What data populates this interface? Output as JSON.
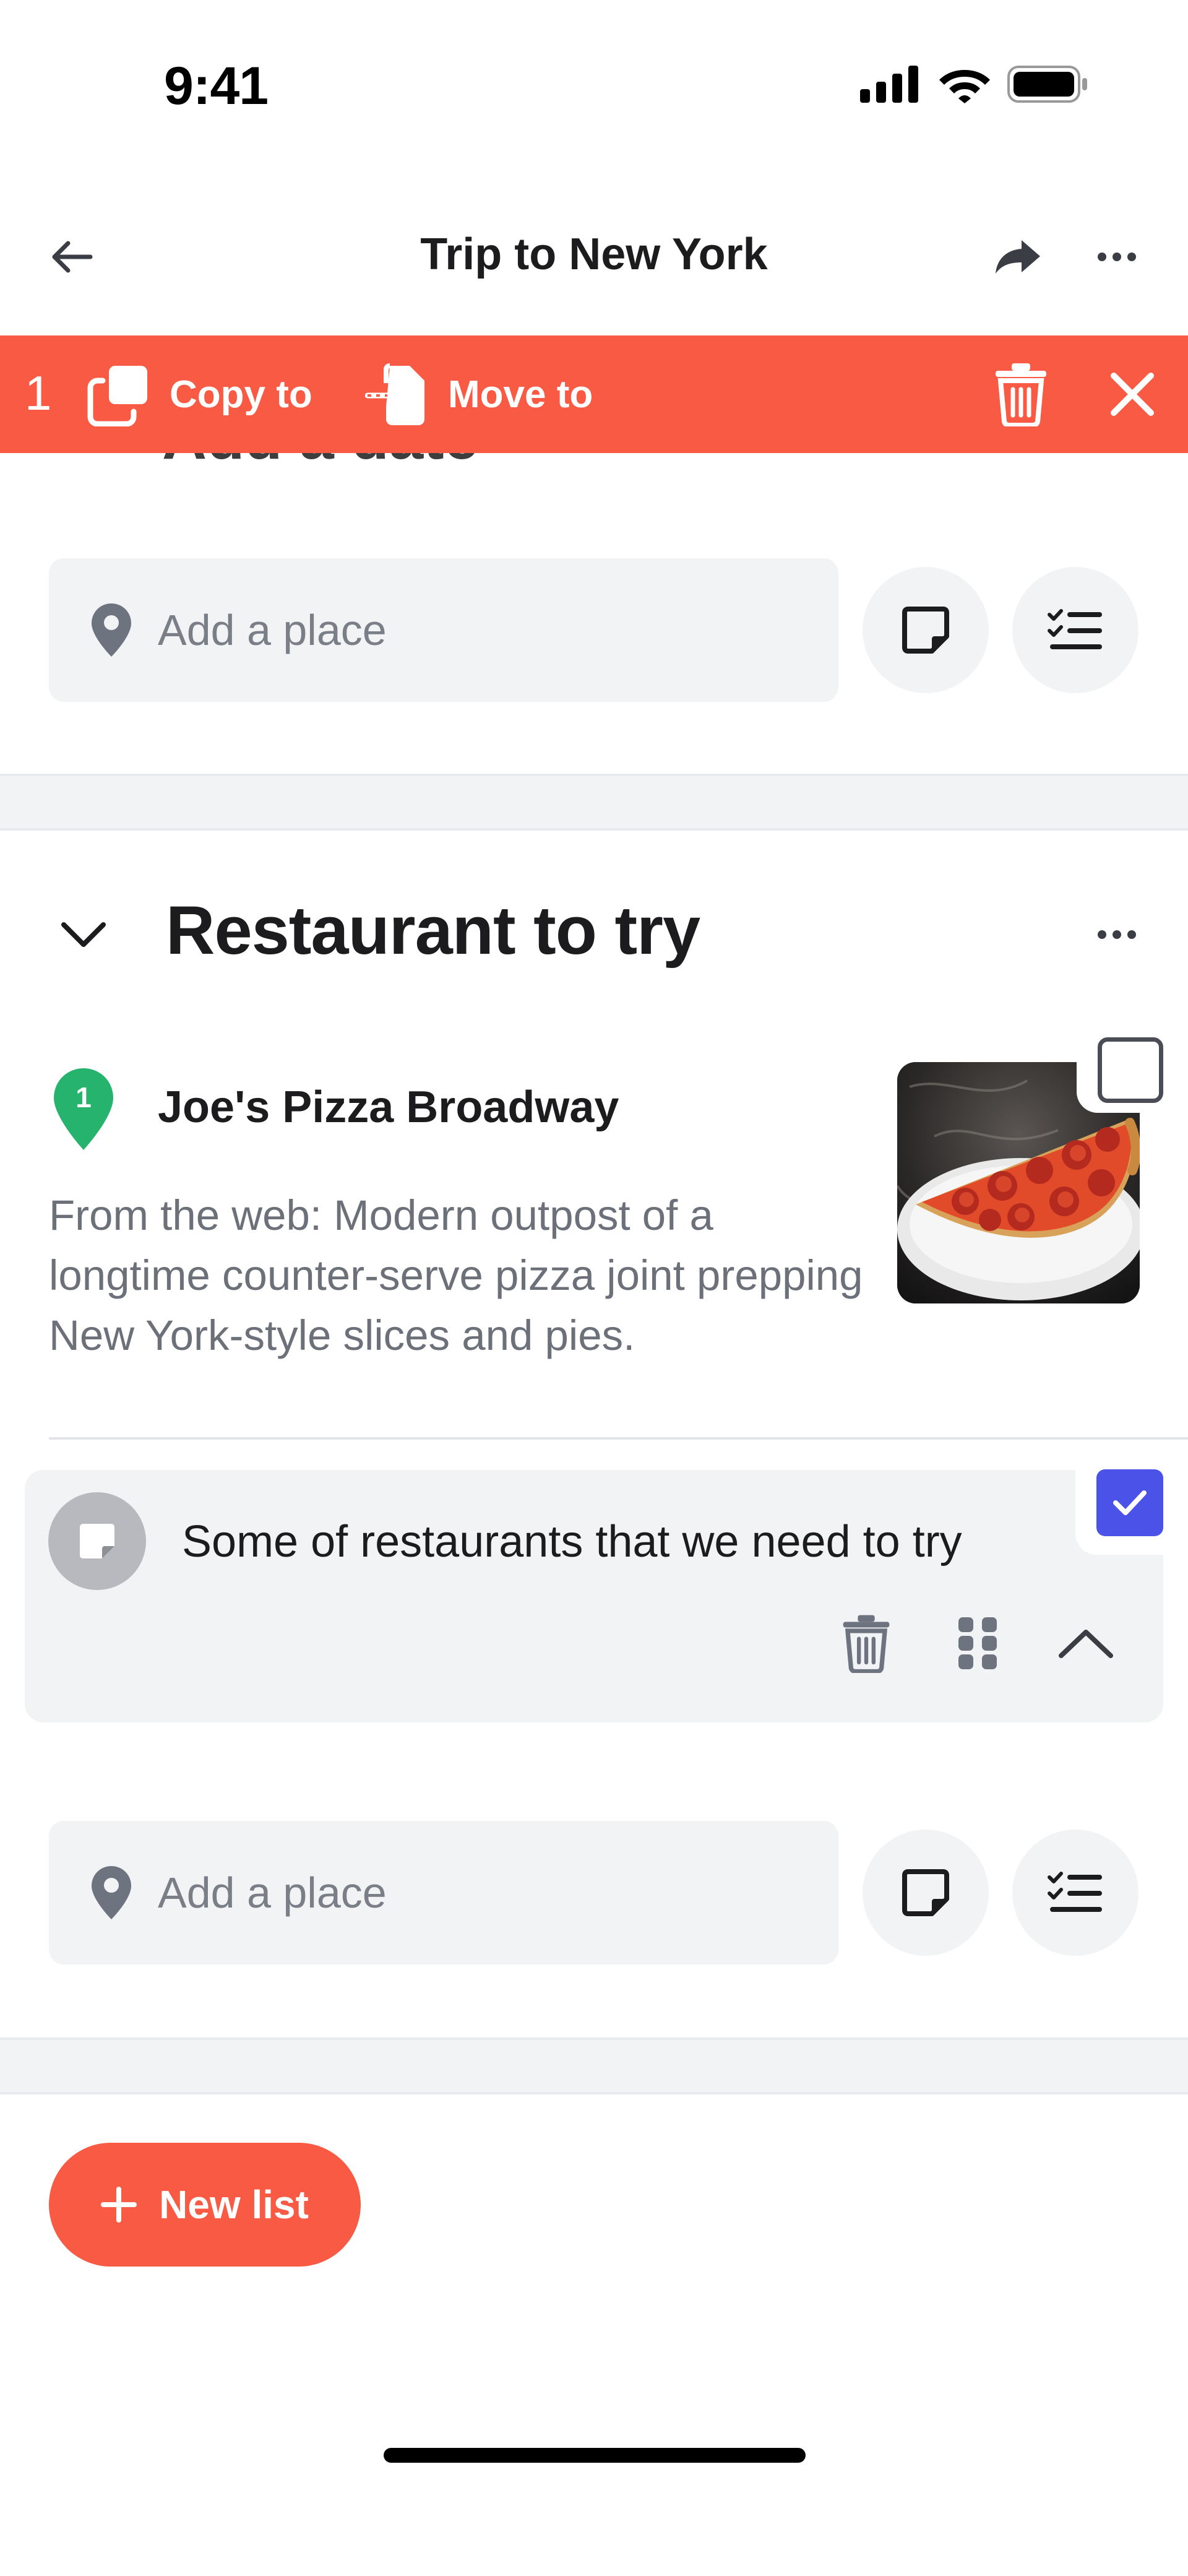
{
  "status_bar": {
    "time": "9:41"
  },
  "nav": {
    "title": "Trip to New York"
  },
  "selection_bar": {
    "count": "1",
    "copy_label": "Copy to",
    "move_label": "Move to",
    "color": "#f85a43"
  },
  "previous_section": {
    "title_partial": "Add a date",
    "add_place_placeholder": "Add a place"
  },
  "section": {
    "title": "Restaurant to try",
    "place": {
      "number": "1",
      "name": "Joe's Pizza Broadway",
      "description": "From the web: Modern outpost of a longtime counter-serve pizza joint prepping New York-style slices and pies.",
      "selected": false,
      "pin_color": "#26b36d"
    },
    "note": {
      "text": "Some of restaurants that we need to try",
      "selected": true,
      "check_color": "#4a52e8"
    },
    "add_place_placeholder": "Add a place"
  },
  "new_list": {
    "label": "New list"
  },
  "icons": [
    "back-arrow-icon",
    "share-icon",
    "more-icon",
    "copy-icon",
    "move-icon",
    "trash-icon",
    "close-icon",
    "location-pin-icon",
    "note-icon",
    "checklist-icon",
    "chevron-down-icon",
    "drag-handle-icon",
    "chevron-up-icon",
    "plus-icon"
  ]
}
